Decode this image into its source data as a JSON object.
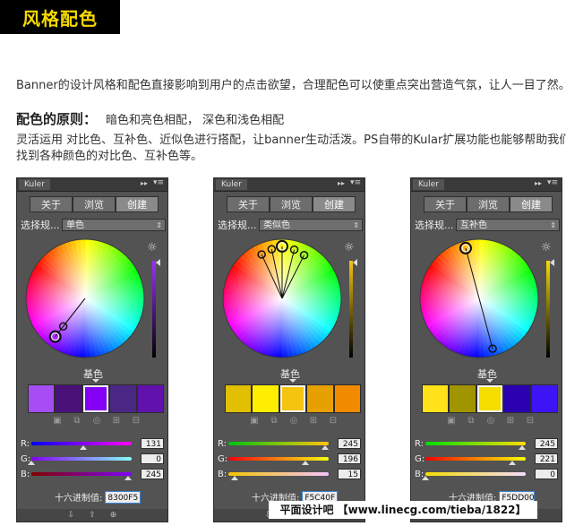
{
  "header": {
    "title": "风格配色"
  },
  "text": {
    "intro": "Banner的设计风格和配色直接影响到用户的点击欲望，合理配色可以使重点突出营造气氛，让人一目了然。",
    "principle_heading": "配色的原则：",
    "principle_body": "暗色和亮色相配，  深色和浅色相配",
    "line2": "灵活运用 对比色、互补色、近似色进行搭配，让banner生动活泼。PS自带的Kular扩展功能也能够帮助我们",
    "line3": "找到各种颜色的对比色、互补色等。"
  },
  "panels": [
    {
      "panel_title": "Kuler",
      "tabs": [
        "关于",
        "浏览",
        "创建"
      ],
      "active_tab": 2,
      "rule_label": "选择规...",
      "rule_value": "单色",
      "base_label": "基色",
      "selected_swatch": 2,
      "swatches": [
        "#a64df5",
        "#4a1178",
        "#8300f5",
        "#4b2785",
        "#6112ad"
      ],
      "brightness_gradient": [
        "#9b30ff",
        "#000000"
      ],
      "rgb": {
        "r": {
          "label": "R:",
          "value": "131",
          "level": 0.514,
          "gradient": [
            "#0000f5",
            "#ff00f5"
          ]
        },
        "g": {
          "label": "G:",
          "value": "0",
          "level": 0.0,
          "gradient": [
            "#8300f5",
            "#83fff5"
          ]
        },
        "b": {
          "label": "B:",
          "value": "245",
          "level": 0.961,
          "gradient": [
            "#830000",
            "#8300ff"
          ]
        }
      },
      "hex_label": "十六进制值:",
      "hex_value": "8300F5",
      "wheel_markers": [
        {
          "angle_deg": 218,
          "radius": 0.82,
          "big": true
        },
        {
          "angle_deg": 218,
          "radius": 0.6,
          "big": false
        }
      ]
    },
    {
      "panel_title": "Kuler",
      "tabs": [
        "关于",
        "浏览",
        "创建"
      ],
      "active_tab": 2,
      "rule_label": "选择规...",
      "rule_value": "类似色",
      "base_label": "基色",
      "selected_swatch": 2,
      "swatches": [
        "#e0c000",
        "#ffee00",
        "#f5c40f",
        "#e6a000",
        "#f28a00"
      ],
      "brightness_gradient": [
        "#f5c40f",
        "#000000"
      ],
      "rgb": {
        "r": {
          "label": "R:",
          "value": "245",
          "level": 0.961,
          "gradient": [
            "#00c40f",
            "#ffc40f"
          ]
        },
        "g": {
          "label": "G:",
          "value": "196",
          "level": 0.769,
          "gradient": [
            "#f5000f",
            "#f5ff0f"
          ]
        },
        "b": {
          "label": "B:",
          "value": "15",
          "level": 0.059,
          "gradient": [
            "#f5c400",
            "#f5c4ff"
          ]
        }
      },
      "hex_label": "十六进制值:",
      "hex_value": "F5C40F",
      "wheel_markers": [
        {
          "angle_deg": 335,
          "radius": 0.82,
          "big": false
        },
        {
          "angle_deg": 348,
          "radius": 0.85,
          "big": false
        },
        {
          "angle_deg": 0,
          "radius": 0.88,
          "big": true
        },
        {
          "angle_deg": 14,
          "radius": 0.85,
          "big": false
        },
        {
          "angle_deg": 27,
          "radius": 0.82,
          "big": false
        }
      ]
    },
    {
      "panel_title": "Kuler",
      "tabs": [
        "关于",
        "浏览",
        "创建"
      ],
      "active_tab": 2,
      "rule_label": "选择规...",
      "rule_value": "互补色",
      "base_label": "基色",
      "selected_swatch": 2,
      "swatches": [
        "#ffe21a",
        "#a09400",
        "#f5dd00",
        "#2a00b0",
        "#3d14f5"
      ],
      "brightness_gradient": [
        "#f5dd00",
        "#000000"
      ],
      "rgb": {
        "r": {
          "label": "R:",
          "value": "245",
          "level": 0.961,
          "gradient": [
            "#00dd00",
            "#ffdd00"
          ]
        },
        "g": {
          "label": "G:",
          "value": "221",
          "level": 0.867,
          "gradient": [
            "#f50000",
            "#f5ff00"
          ]
        },
        "b": {
          "label": "B:",
          "value": "0",
          "level": 0.0,
          "gradient": [
            "#f5dd00",
            "#f5ddff"
          ]
        }
      },
      "hex_label": "十六进制值:",
      "hex_value": "F5DD00",
      "wheel_markers": [
        {
          "angle_deg": 345,
          "radius": 0.88,
          "big": true
        },
        {
          "angle_deg": 165,
          "radius": 0.88,
          "big": false
        }
      ]
    }
  ],
  "watermark": "平面设计吧 【www.linecg.com/tieba/1822】"
}
